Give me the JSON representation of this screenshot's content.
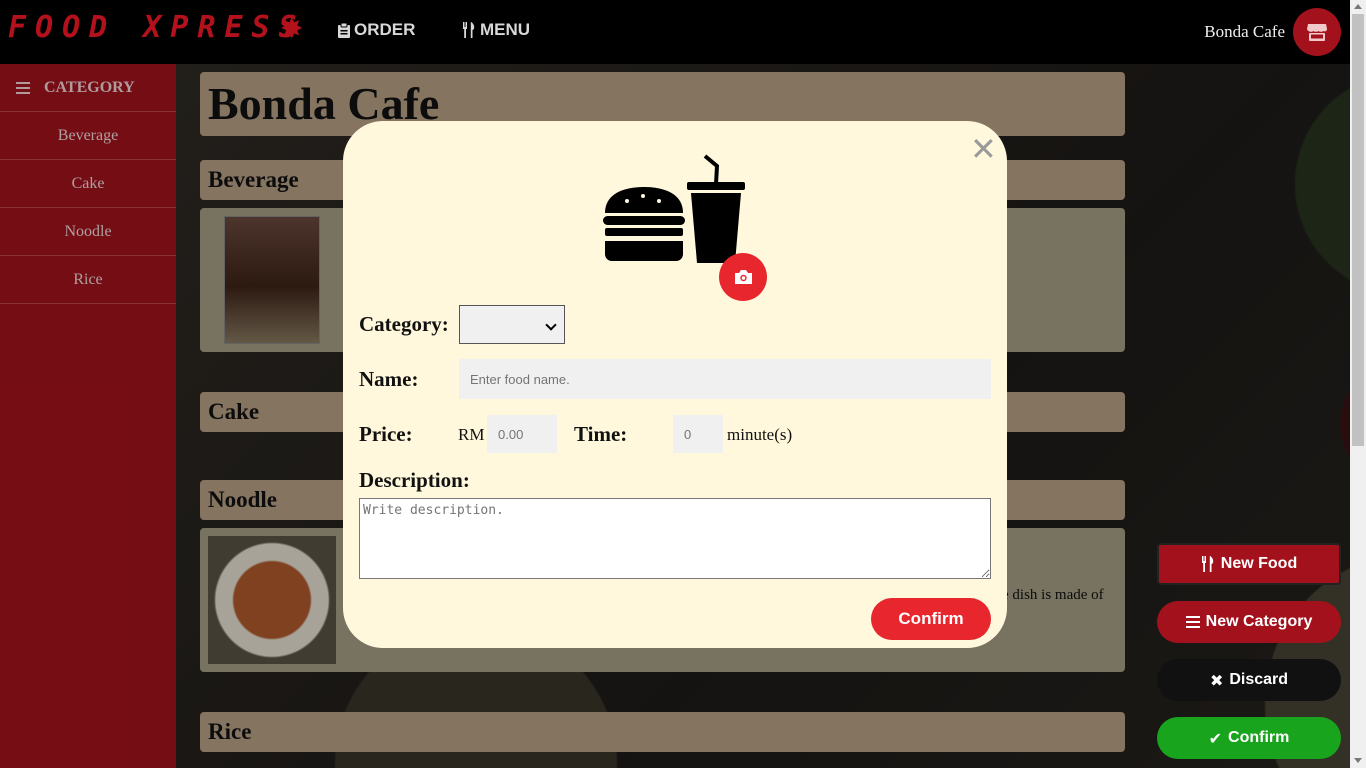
{
  "header": {
    "logo": "FOOD XPRESS",
    "nav": [
      {
        "label": "ORDER",
        "icon": "clipboard-icon"
      },
      {
        "label": "MENU",
        "icon": "utensils-icon"
      }
    ],
    "shop_name": "Bonda Cafe",
    "shop_icon": "store-icon"
  },
  "sidebar": {
    "title": "CATEGORY",
    "items": [
      "Beverage",
      "Cake",
      "Noodle",
      "Rice"
    ]
  },
  "main": {
    "page_title": "Bonda Cafe",
    "sections": [
      "Beverage",
      "Cake",
      "Noodle",
      "Rice"
    ],
    "noodle_desc_fragment": "e dish is made of"
  },
  "actions": {
    "new_food": "New Food",
    "new_category": "New Category",
    "discard": "Discard",
    "confirm": "Confirm"
  },
  "modal": {
    "category_label": "Category:",
    "category_value": "",
    "name_label": "Name:",
    "name_placeholder": "Enter food name.",
    "price_label": "Price:",
    "currency": "RM",
    "price_placeholder": "0.00",
    "time_label": "Time:",
    "time_placeholder": "0",
    "time_unit": "minute(s)",
    "description_label": "Description:",
    "description_placeholder": "Write description.",
    "confirm": "Confirm"
  },
  "colors": {
    "brand_red": "#a3121c",
    "accent_red": "#e8262e",
    "confirm_green": "#18a41c",
    "modal_bg": "#fff8dc"
  }
}
